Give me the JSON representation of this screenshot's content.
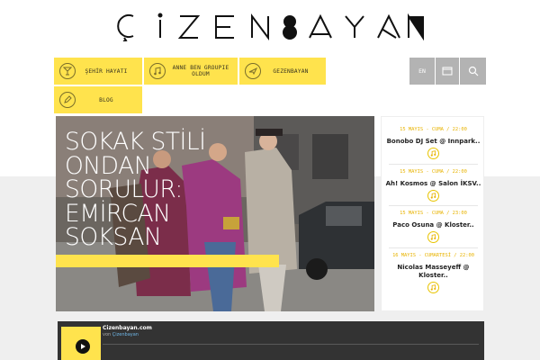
{
  "brand": {
    "logo_text": "ÇİZENBAYAN"
  },
  "nav": {
    "items": [
      {
        "label": "ŞEHİR HAYATI",
        "icon": "cocktail-icon"
      },
      {
        "label": "ANNE BEN GROUPIE OLDUM",
        "icon": "music-note-icon"
      },
      {
        "label": "GEZENBAYAN",
        "icon": "plane-icon"
      },
      {
        "label": "BLOG",
        "icon": "pencil-icon"
      }
    ],
    "lang_label": "EN"
  },
  "hero": {
    "title_lines": [
      "SOKAK STİLİ",
      "ONDAN",
      "SORULUR:",
      "EMİRCAN",
      "SOKSAN"
    ]
  },
  "events": [
    {
      "date": "15 MAYIS - CUMA    /    22:00",
      "title": "Bonobo DJ Set @ Innpark.."
    },
    {
      "date": "15 MAYIS - CUMA    /    22:00",
      "title": "Ah! Kosmos @ Salon İKSV.."
    },
    {
      "date": "15 MAYIS - CUMA    /    23:00",
      "title": "Paco Osuna @ Kloster.."
    },
    {
      "date": "16 MAYIS - CUMARTESİ    /    22:00",
      "title": "Nicolas Masseyeff @ Kloster.."
    }
  ],
  "player": {
    "title": "Cizenbayan.com",
    "from_prefix": "von",
    "from_author": "Çizenbayan"
  },
  "colors": {
    "accent": "#ffe34d",
    "utility_gray": "#b3b3b3",
    "date_yellow": "#e8b300",
    "player_dark": "#333333"
  }
}
